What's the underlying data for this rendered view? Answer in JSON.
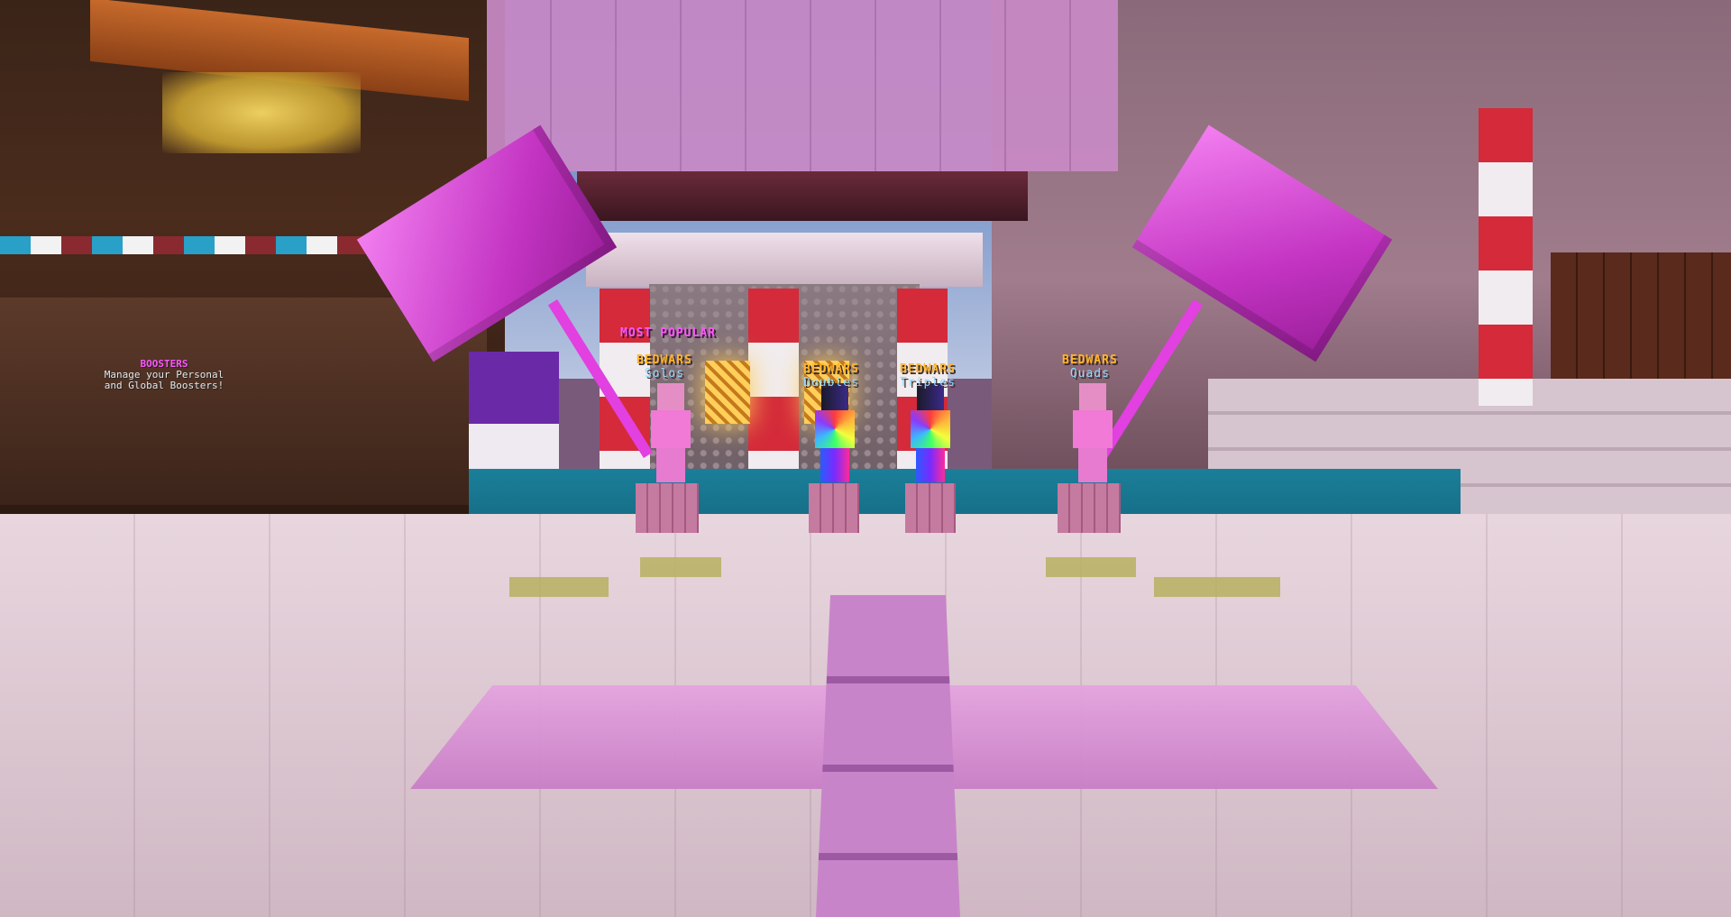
{
  "hologram": {
    "most_popular": "MOST POPULAR"
  },
  "npcs": [
    {
      "title": "BEDWARS",
      "mode": "Solos",
      "skin": "pink"
    },
    {
      "title": "BEDWARS",
      "mode": "Doubles",
      "skin": "rainbow"
    },
    {
      "title": "BEDWARS",
      "mode": "Triples",
      "skin": "rainbow"
    },
    {
      "title": "BEDWARS",
      "mode": "Quads",
      "skin": "pink"
    }
  ],
  "boosters": {
    "title": "BOOSTERS",
    "line1": "Manage your Personal",
    "line2": "and Global Boosters!"
  },
  "colors": {
    "hammer": "#e040e0",
    "npc_title": "#ffb52a",
    "npc_mode": "#8fd9ff",
    "most_popular": "#ff55ff"
  }
}
